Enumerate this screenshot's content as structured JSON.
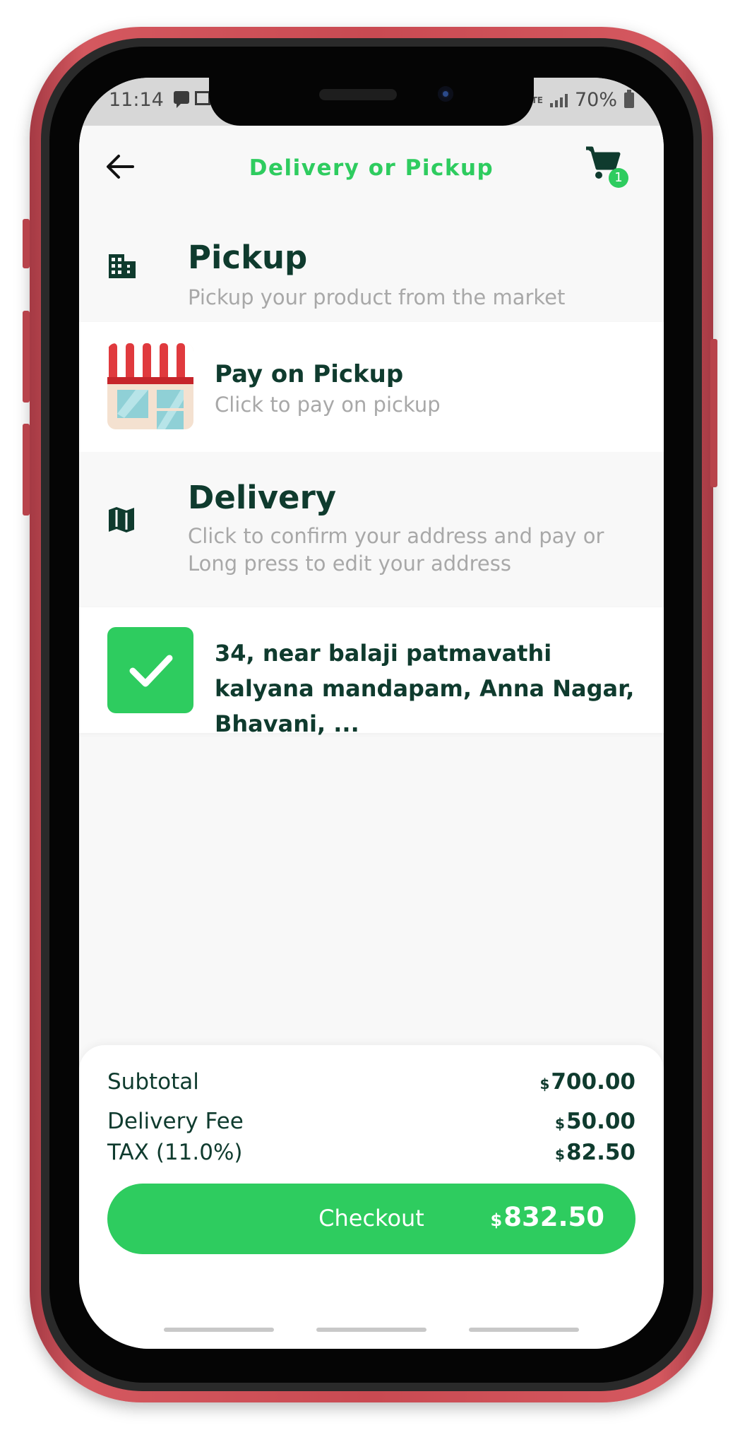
{
  "status_bar": {
    "time": "11:14",
    "lte": "LTE",
    "battery": "70%"
  },
  "header": {
    "title": "Delivery or Pickup",
    "cart_count": "1"
  },
  "pickup": {
    "title": "Pickup",
    "subtitle": "Pickup your product from the market",
    "option": {
      "title": "Pay on Pickup",
      "subtitle": "Click to pay on pickup"
    }
  },
  "delivery": {
    "title": "Delivery",
    "subtitle": "Click to confirm your address and pay or Long press to edit your address",
    "address": "34, near balaji patmavathi kalyana mandapam, Anna Nagar, Bhavani, ..."
  },
  "summary": {
    "currency": "$",
    "subtotal_label": "Subtotal",
    "subtotal": "700.00",
    "delivery_label": "Delivery Fee",
    "delivery": "50.00",
    "tax_label": "TAX (11.0%)",
    "tax": "82.50",
    "checkout_label": "Checkout",
    "total": "832.50"
  },
  "colors": {
    "accent": "#2ecc5f",
    "text_dark": "#0f3b2e",
    "text_muted": "#a8a8a8",
    "frame": "#c94a52"
  },
  "icons": [
    "back-arrow-icon",
    "cart-icon",
    "building-icon",
    "store-icon",
    "map-icon",
    "check-icon"
  ]
}
